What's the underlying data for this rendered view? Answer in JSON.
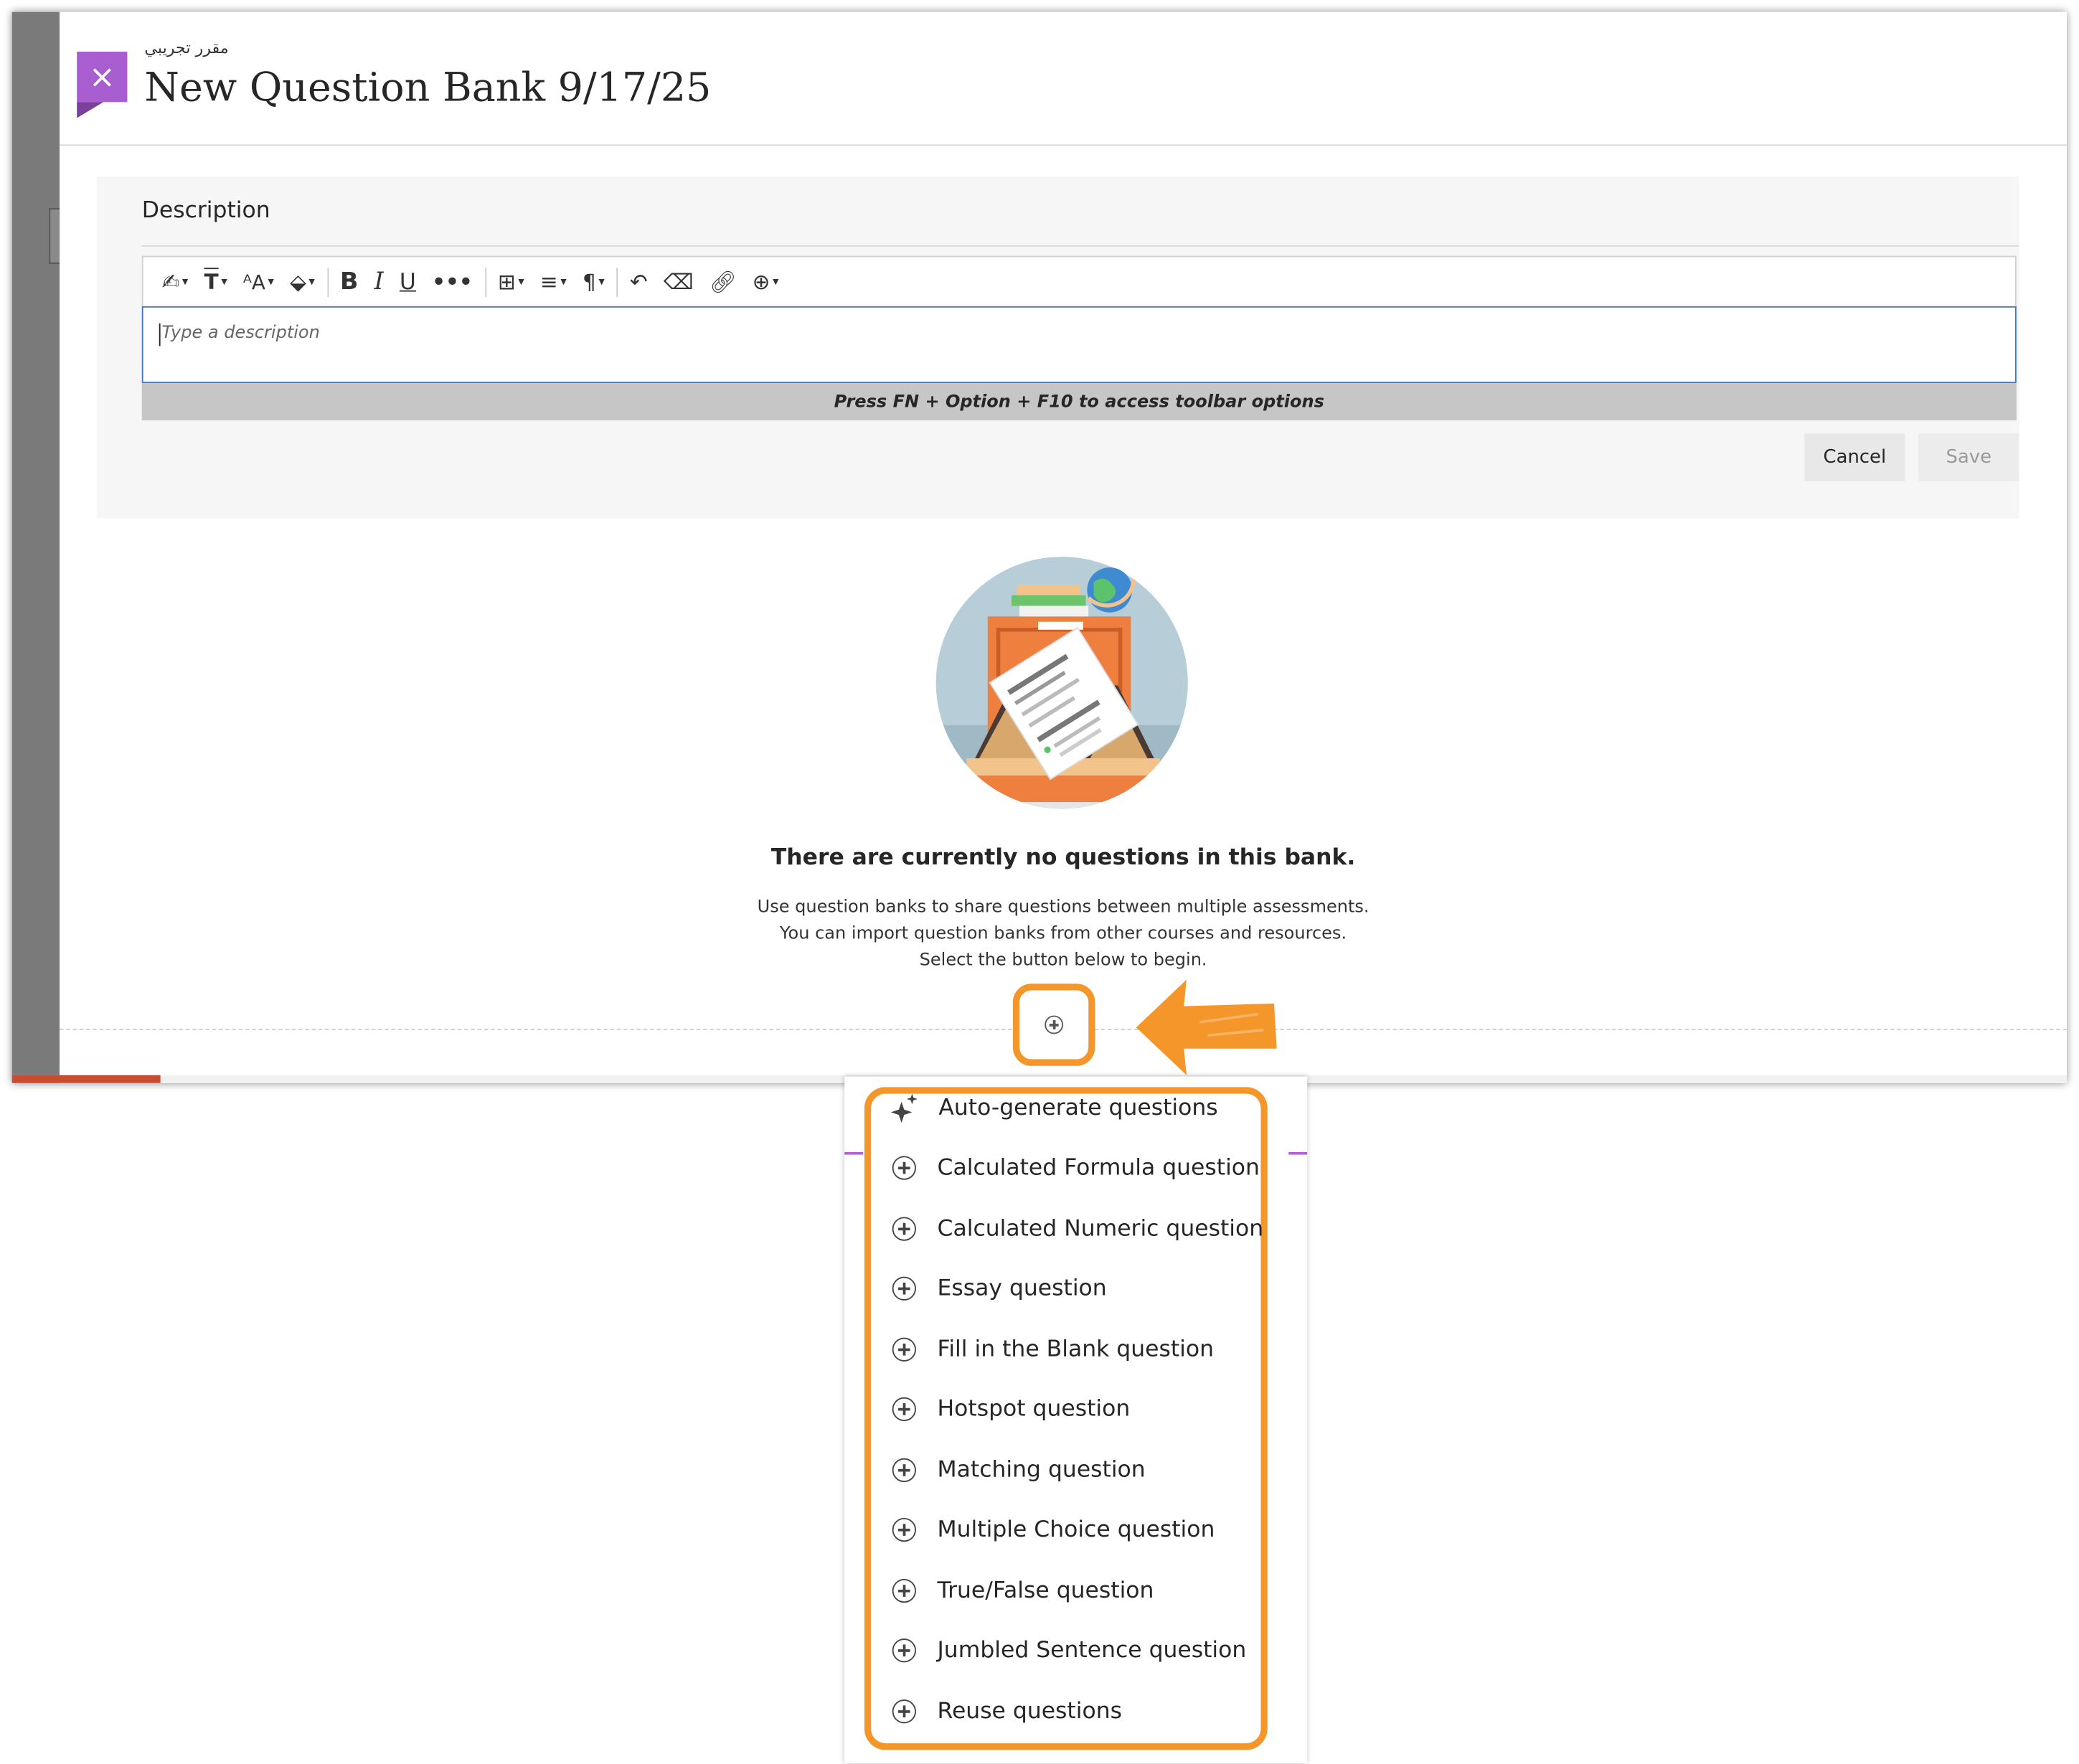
{
  "header": {
    "breadcrumb": "مقرر تجريبي",
    "title": "New Question Bank 9/17/25",
    "close_label": "×"
  },
  "editor": {
    "label": "Description",
    "placeholder": "Type a description",
    "hint": "Press FN + Option + F10 to access toolbar options",
    "toolbar": [
      "paragraph-style",
      "formatting",
      "font-size",
      "text-color",
      "bold",
      "italic",
      "underline",
      "more",
      "insert-table",
      "align",
      "paragraph",
      "undo",
      "clear-format",
      "link",
      "insert-content"
    ],
    "cancel_label": "Cancel",
    "save_label": "Save"
  },
  "empty_state": {
    "title": "There are currently no questions in this bank.",
    "line1": "Use question banks to share questions between multiple assessments.",
    "line2": "You can import question banks from other courses and resources.",
    "line3": "Select the button below to begin."
  },
  "menu": {
    "items": [
      {
        "label": "Auto-generate questions",
        "icon": "sparkle-icon"
      },
      {
        "label": "Calculated Formula question",
        "icon": "plus-circle-icon"
      },
      {
        "label": "Calculated Numeric question",
        "icon": "plus-circle-icon"
      },
      {
        "label": "Essay question",
        "icon": "plus-circle-icon"
      },
      {
        "label": "Fill in the Blank question",
        "icon": "plus-circle-icon"
      },
      {
        "label": "Hotspot question",
        "icon": "plus-circle-icon"
      },
      {
        "label": "Matching question",
        "icon": "plus-circle-icon"
      },
      {
        "label": "Multiple Choice question",
        "icon": "plus-circle-icon"
      },
      {
        "label": "True/False question",
        "icon": "plus-circle-icon"
      },
      {
        "label": "Jumbled Sentence question",
        "icon": "plus-circle-icon"
      },
      {
        "label": "Reuse questions",
        "icon": "plus-circle-icon"
      }
    ]
  },
  "colors": {
    "accent_orange": "#f5962a",
    "close_purple": "#a85dd1",
    "focus_blue": "#3e7ac5"
  }
}
